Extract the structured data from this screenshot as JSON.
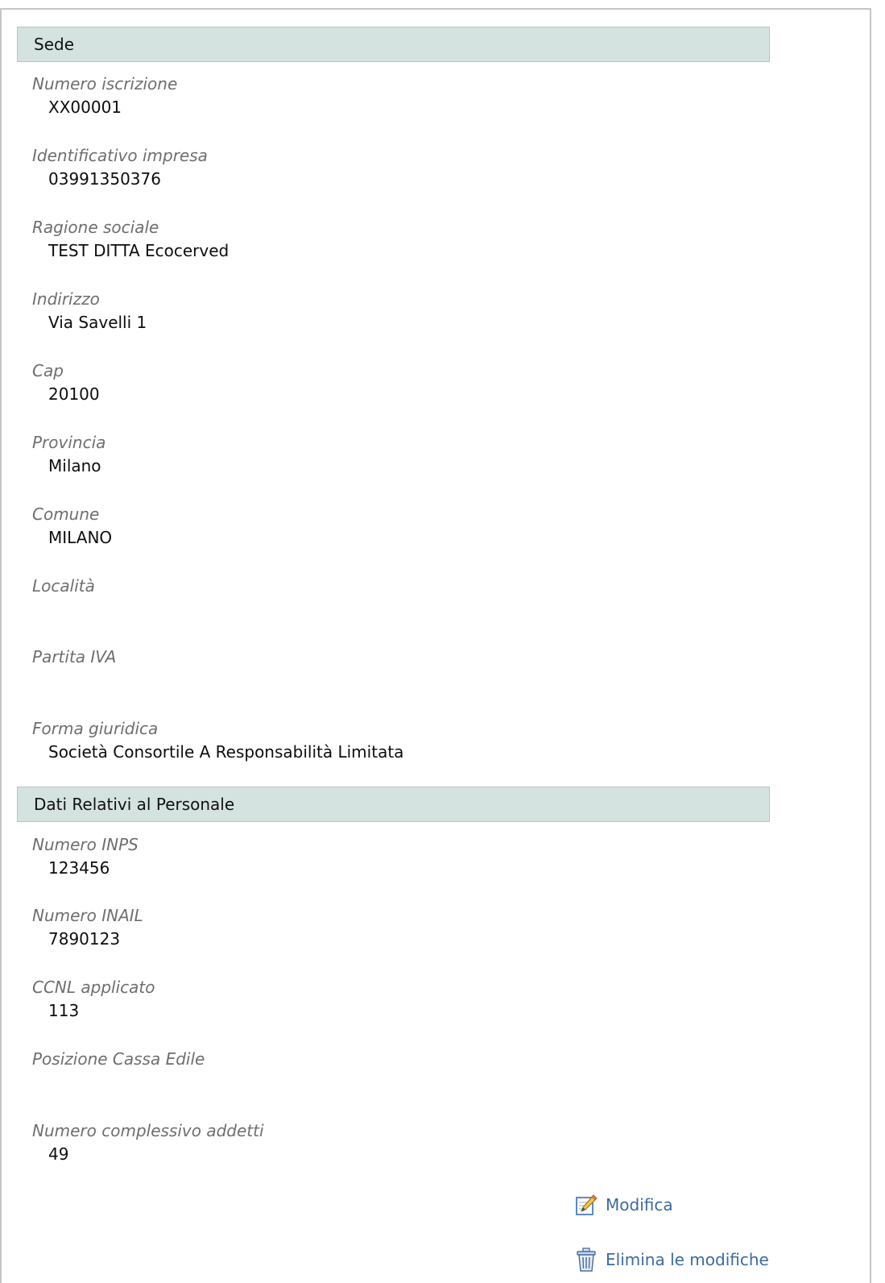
{
  "sections": [
    {
      "title": "Sede",
      "fields": [
        {
          "label": "Numero iscrizione",
          "value": "XX00001"
        },
        {
          "label": "Identificativo impresa",
          "value": "03991350376"
        },
        {
          "label": "Ragione sociale",
          "value": "TEST DITTA Ecocerved"
        },
        {
          "label": "Indirizzo",
          "value": "Via Savelli 1"
        },
        {
          "label": "Cap",
          "value": "20100"
        },
        {
          "label": "Provincia",
          "value": "Milano"
        },
        {
          "label": "Comune",
          "value": "MILANO"
        },
        {
          "label": "Località",
          "value": ""
        },
        {
          "label": "Partita IVA",
          "value": ""
        },
        {
          "label": "Forma giuridica",
          "value": "Società Consortile A Responsabilità Limitata"
        }
      ]
    },
    {
      "title": "Dati Relativi al Personale",
      "fields": [
        {
          "label": "Numero INPS",
          "value": "123456"
        },
        {
          "label": "Numero INAIL",
          "value": "7890123"
        },
        {
          "label": "CCNL applicato",
          "value": "113"
        },
        {
          "label": "Posizione Cassa Edile",
          "value": ""
        },
        {
          "label": "Numero complessivo addetti",
          "value": "49"
        }
      ]
    }
  ],
  "actions": {
    "edit": {
      "label": "Modifica",
      "icon": "pencil-edit-icon"
    },
    "discard": {
      "label": "Elimina le modifiche",
      "icon": "trash-can-icon"
    }
  },
  "colors": {
    "section_header_bg": "#d5e3e0",
    "label_text": "#6e6e6e",
    "link_text": "#3b6aa0",
    "panel_border": "#c6c6c6"
  }
}
